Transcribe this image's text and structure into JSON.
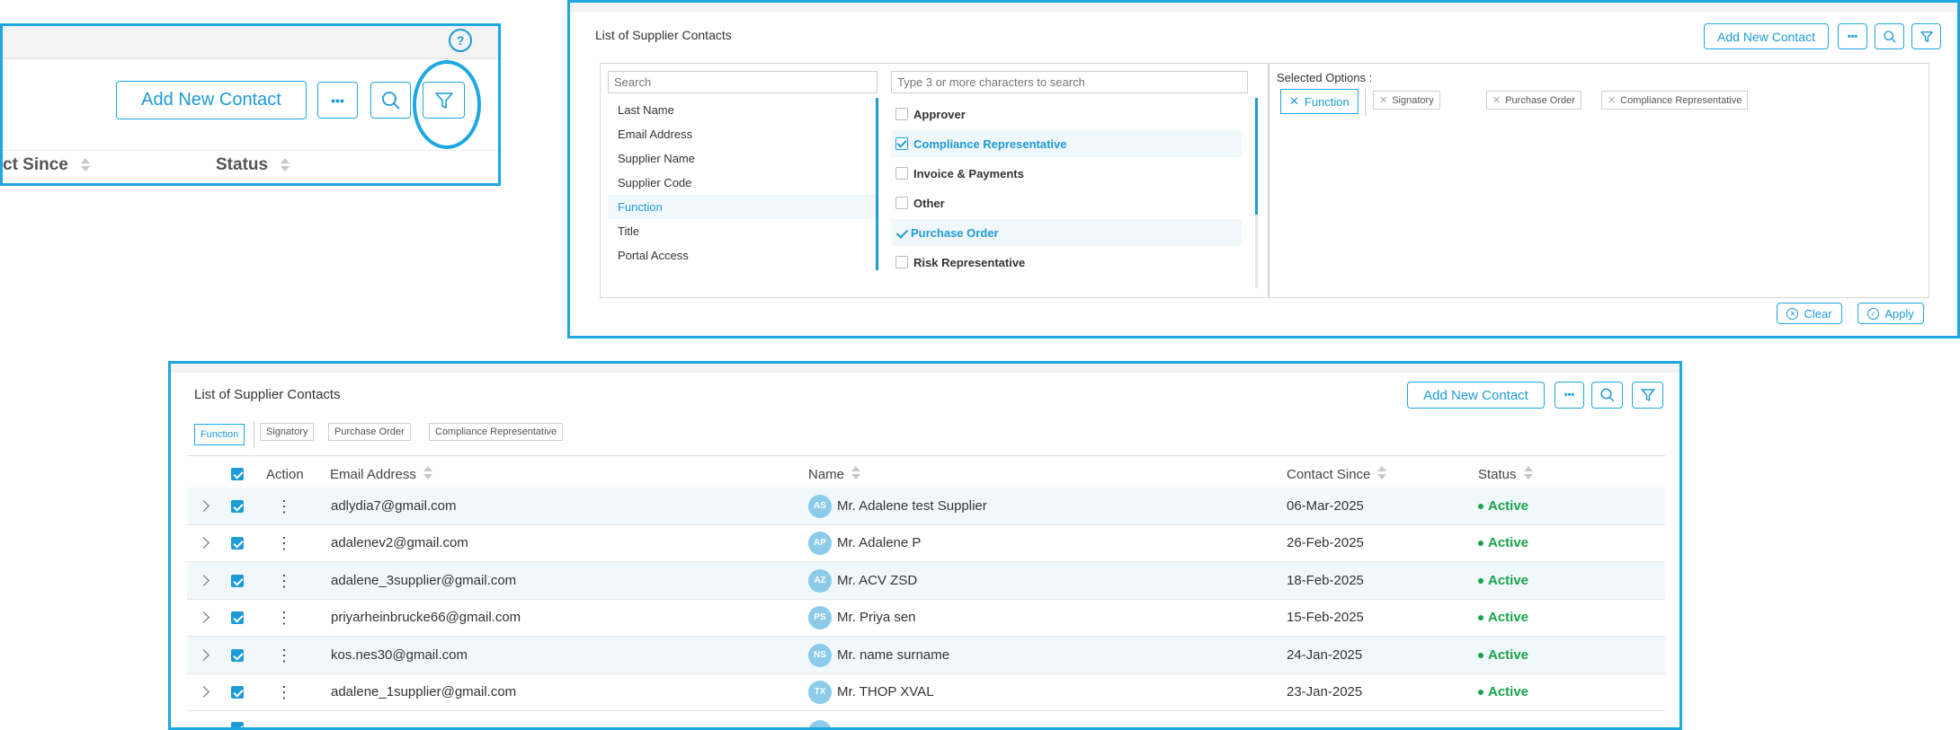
{
  "zoom_panel": {
    "help_icon": "?",
    "add_button": "Add New Contact",
    "more_label": "•••",
    "col_contact_since": "ct Since",
    "col_status": "Status"
  },
  "filter_panel": {
    "title": "List of Supplier Contacts",
    "add_button": "Add New Contact",
    "more_label": "•••",
    "search_placeholder": "Search",
    "options_placeholder": "Type 3 or more characters to search",
    "fields": [
      "Last Name",
      "Email Address",
      "Supplier Name",
      "Supplier Code",
      "Function",
      "Title",
      "Portal Access"
    ],
    "options": [
      {
        "label": "Approver",
        "state": "unchecked"
      },
      {
        "label": "Compliance Representative",
        "state": "checked"
      },
      {
        "label": "Invoice & Payments",
        "state": "unchecked"
      },
      {
        "label": "Other",
        "state": "unchecked"
      },
      {
        "label": "Purchase Order",
        "state": "tick"
      },
      {
        "label": "Risk Representative",
        "state": "unchecked"
      }
    ],
    "selected_title": "Selected Options :",
    "selected_function": "Function",
    "selected_chips": [
      "Signatory",
      "Purchase Order",
      "Compliance Representative"
    ],
    "clear_button": "Clear",
    "apply_button": "Apply"
  },
  "table_panel": {
    "title": "List of Supplier Contacts",
    "add_button": "Add New Contact",
    "more_label": "•••",
    "filter_chips": [
      "Function",
      "Signatory",
      "Purchase Order",
      "Compliance Representative"
    ],
    "columns": {
      "action": "Action",
      "email": "Email Address",
      "name": "Name",
      "contact_since": "Contact Since",
      "status": "Status"
    },
    "rows": [
      {
        "email": "adlydia7@gmail.com",
        "initials": "AS",
        "name": "Mr. Adalene test Supplier",
        "since": "06-Mar-2025",
        "status": "Active"
      },
      {
        "email": "adalenev2@gmail.com",
        "initials": "AP",
        "name": "Mr. Adalene P",
        "since": "26-Feb-2025",
        "status": "Active"
      },
      {
        "email": "adalene_3supplier@gmail.com",
        "initials": "AZ",
        "name": "Mr. ACV ZSD",
        "since": "18-Feb-2025",
        "status": "Active"
      },
      {
        "email": "priyarheinbrucke66@gmail.com",
        "initials": "PS",
        "name": "Mr. Priya sen",
        "since": "15-Feb-2025",
        "status": "Active"
      },
      {
        "email": "kos.nes30@gmail.com",
        "initials": "NS",
        "name": "Mr. name surname",
        "since": "24-Jan-2025",
        "status": "Active"
      },
      {
        "email": "adalene_1supplier@gmail.com",
        "initials": "TX",
        "name": "Mr. THOP XVAL",
        "since": "23-Jan-2025",
        "status": "Active"
      }
    ]
  },
  "colors": {
    "accent": "#1e9bd6",
    "highlight_border": "#1ea7e0",
    "row_alt": "#f1f8fc",
    "active_green": "#17a34a",
    "avatar": "#8ccbea"
  }
}
